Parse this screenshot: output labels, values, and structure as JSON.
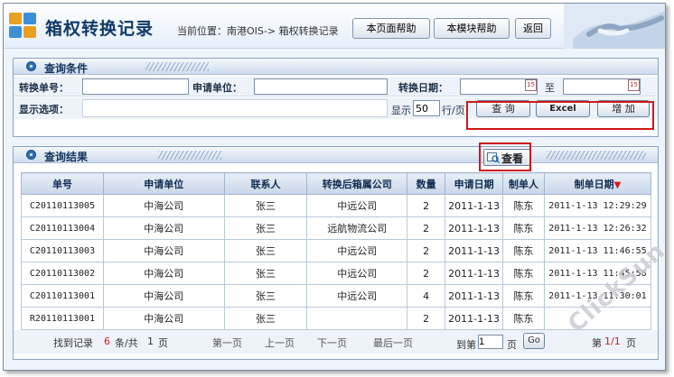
{
  "header": {
    "title": "箱权转换记录",
    "breadcrumb": "当前位置：南港OIS-> 箱权转换记录",
    "buttons": [
      "本页面帮助",
      "本模块帮助",
      "返回"
    ]
  },
  "query": {
    "panel_title": "查询条件",
    "convert_no_label": "转换单号：",
    "convert_no_value": "",
    "apply_unit_label": "申请单位：",
    "apply_unit_value": "",
    "convert_date_label": "转换日期：",
    "date_from": "",
    "date_to_label": "至",
    "date_to": "",
    "calendar_icon_text": "15",
    "display_label": "显示选项：",
    "show_prefix": "显示",
    "page_size": "50",
    "show_suffix": "行/页",
    "query_button": "查 询",
    "excel_button": "Excel",
    "add_button": "增 加"
  },
  "results": {
    "panel_title": "查询结果",
    "view_button": "查看",
    "columns": [
      "单号",
      "申请单位",
      "联系人",
      "转换后箱属公司",
      "数量",
      "申请日期",
      "制单人",
      "制单日期"
    ],
    "sort_marker": "▼",
    "rows": [
      [
        "C20110113005",
        "中海公司",
        "张三",
        "中远公司",
        "2",
        "2011-1-13",
        "陈东",
        "2011-1-13 12:29:29"
      ],
      [
        "C20110113004",
        "中海公司",
        "张三",
        "远航物流公司",
        "2",
        "2011-1-13",
        "陈东",
        "2011-1-13 12:26:32"
      ],
      [
        "C20110113003",
        "中海公司",
        "张三",
        "中远公司",
        "2",
        "2011-1-13",
        "陈东",
        "2011-1-13 11:46:55"
      ],
      [
        "C20110113002",
        "中海公司",
        "张三",
        "中远公司",
        "2",
        "2011-1-13",
        "陈东",
        "2011-1-13 11:45:58"
      ],
      [
        "C20110113001",
        "中海公司",
        "张三",
        "中远公司",
        "4",
        "2011-1-13",
        "陈东",
        "2011-1-13 11:30:01"
      ],
      [
        "R20110113001",
        "中海公司",
        "张三",
        "",
        "2",
        "2011-1-13",
        "陈东",
        ""
      ]
    ]
  },
  "pager": {
    "found_prefix": "找到记录",
    "record_count": "6",
    "mid": "条/共",
    "page_total": "1",
    "pages_suffix": "页",
    "first": "第一页",
    "prev": "上一页",
    "next": "下一页",
    "last": "最后一页",
    "goto_prefix": "到第",
    "goto_value": "1",
    "goto_suffix": "页",
    "go_button": "Go",
    "current_prefix": "第",
    "current": "1/1",
    "current_suffix": "页"
  },
  "watermark": "ClickSun",
  "colors": {
    "accent": "#0f3a66",
    "highlight_box": "#d11818"
  }
}
